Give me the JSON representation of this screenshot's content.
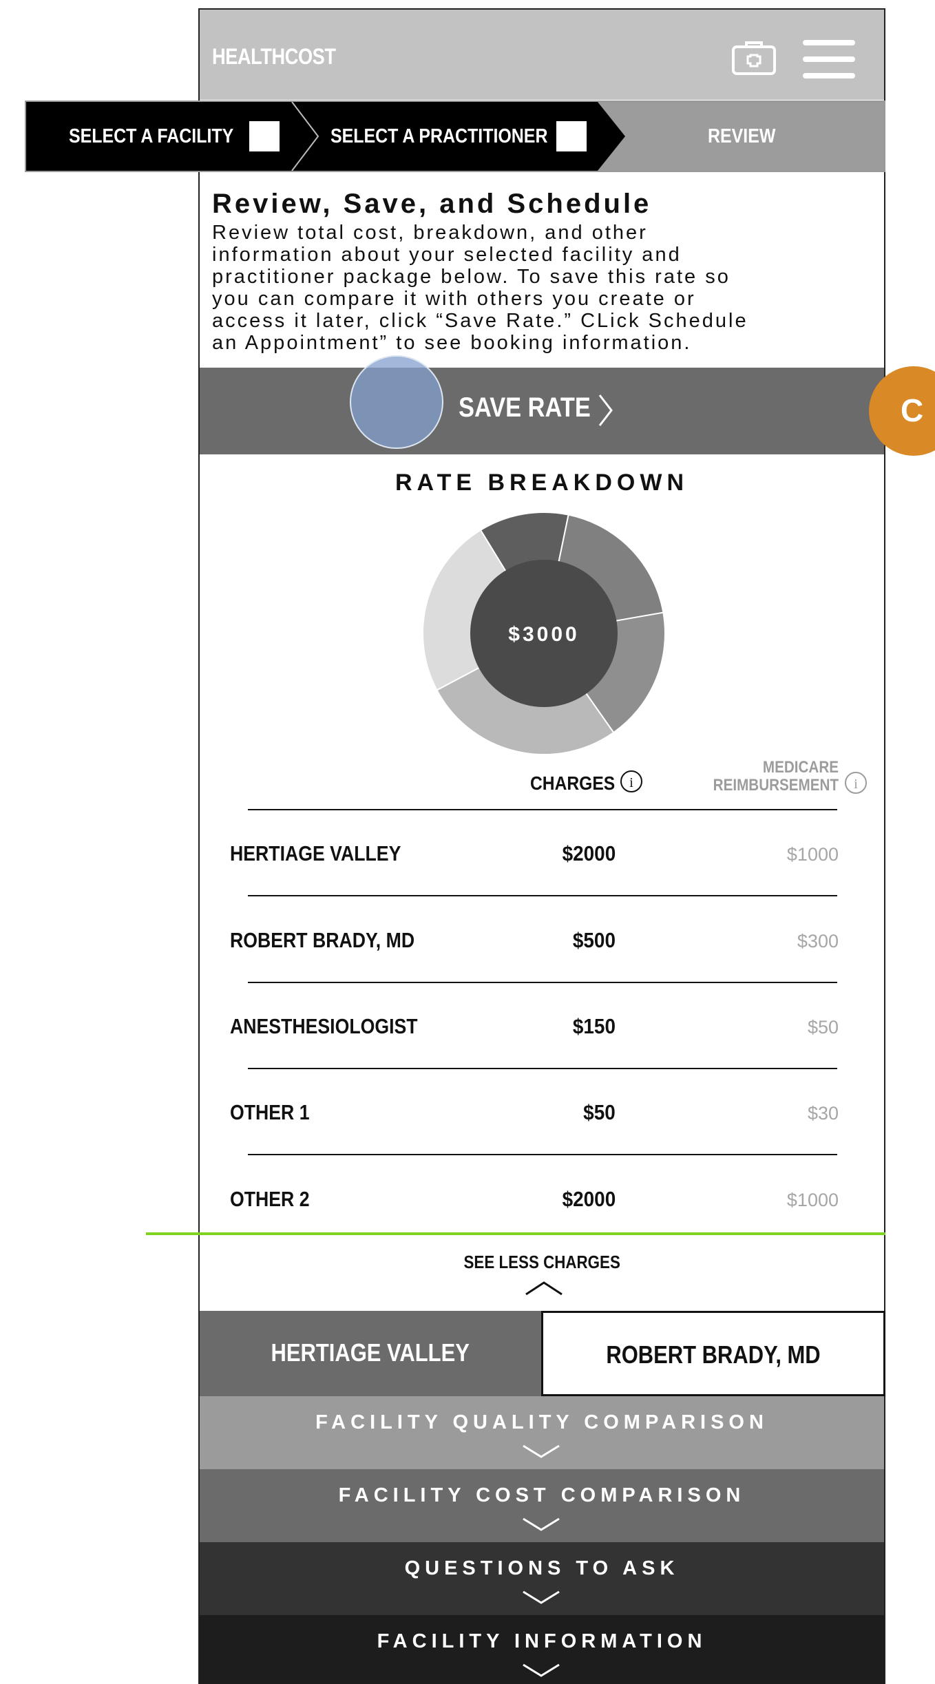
{
  "header": {
    "brand": "HEALTHCOST",
    "kit_icon": "medical-kit-icon",
    "menu_icon": "hamburger-menu-icon"
  },
  "steps": [
    {
      "label": "SELECT A FACILITY",
      "checked": false
    },
    {
      "label": "SELECT A PRACTITIONER",
      "checked": false
    },
    {
      "label": "REVIEW",
      "active": true
    }
  ],
  "intro": {
    "title": "Review, Save, and Schedule",
    "lines": [
      "Review total cost, breakdown, and other",
      "information about your selected facility and",
      "practitioner package below. To save this rate so",
      "you can compare it with others you create or",
      "access it later, click “Save Rate.” CLick Schedule",
      "an Appointment” to see booking information."
    ]
  },
  "save": {
    "label": "SAVE RATE",
    "icon": "chevron-right-icon"
  },
  "badge": {
    "label": "C",
    "color": "#d98a27"
  },
  "breakdown": {
    "title": "RATE BREAKDOWN",
    "total": "$3000",
    "segment_colors": [
      "#5e5e5e",
      "#808080",
      "#8f8f8f",
      "#b9b9b9",
      "#dcdcdc"
    ],
    "segment_fractions": [
      0.12,
      0.19,
      0.18,
      0.27,
      0.24
    ],
    "col_charges": "CHARGES",
    "col_medicare_line1": "MEDICARE",
    "col_medicare_line2": "REIMBURSEMENT",
    "rows": [
      {
        "name": "HERTIAGE VALLEY",
        "charge": "$2000",
        "medicare": "$1000"
      },
      {
        "name": "ROBERT BRADY, MD",
        "charge": "$500",
        "medicare": "$300"
      },
      {
        "name": "ANESTHESIOLOGIST",
        "charge": "$150",
        "medicare": "$50"
      },
      {
        "name": "OTHER 1",
        "charge": "$50",
        "medicare": "$30"
      },
      {
        "name": "OTHER 2",
        "charge": "$2000",
        "medicare": "$1000"
      }
    ],
    "see_less": "SEE LESS CHARGES"
  },
  "tabs": [
    {
      "label": "HERTIAGE VALLEY",
      "active": true
    },
    {
      "label": "ROBERT BRADY, MD",
      "active": false
    }
  ],
  "accordions": [
    {
      "label": "FACILITY QUALITY COMPARISON",
      "color": "#9b9b9b"
    },
    {
      "label": "FACILITY COST COMPARISON",
      "color": "#6b6b6b"
    },
    {
      "label": "QUESTIONS TO ASK",
      "color": "#333333"
    },
    {
      "label": "FACILITY INFORMATION",
      "color": "#1d1d1d"
    }
  ]
}
